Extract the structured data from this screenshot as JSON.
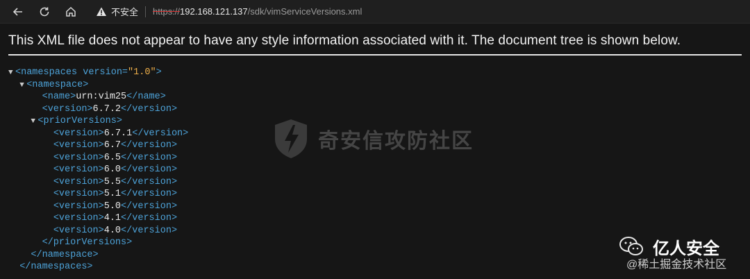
{
  "browser": {
    "back_icon": "back-arrow-icon",
    "reload_icon": "reload-icon",
    "home_icon": "home-icon",
    "security_label": "不安全",
    "url_scheme": "https://",
    "url_host": "192.168.121.137",
    "url_path": "/sdk/vimServiceVersions.xml"
  },
  "info_message": "This XML file does not appear to have any style information associated with it. The document tree is shown below.",
  "xml": {
    "fold_glyph": "▼",
    "namespaces_open": "<namespaces",
    "version_attr_name": " version=",
    "version_attr_value": "\"1.0\"",
    "namespaces_open_end": ">",
    "namespace_open": "<namespace>",
    "name_open": "<name>",
    "name_value": "urn:vim25",
    "name_close": "</name>",
    "version_open": "<version>",
    "version_close": "</version>",
    "current_version": "6.7.2",
    "priorVersions_open": "<priorVersions>",
    "prior_versions": [
      "6.7.1",
      "6.7",
      "6.5",
      "6.0",
      "5.5",
      "5.1",
      "5.0",
      "4.1",
      "4.0"
    ],
    "priorVersions_close": "</priorVersions>",
    "namespace_close": "</namespace>",
    "namespaces_close": "</namespaces>"
  },
  "watermarks": {
    "center_text": "奇安信攻防社区",
    "br_title": "亿人安全",
    "br_sub": "@稀土掘金技术社区"
  },
  "colors": {
    "tag": "#4da3d9",
    "attr_value": "#f0b04a",
    "background": "#161616"
  }
}
